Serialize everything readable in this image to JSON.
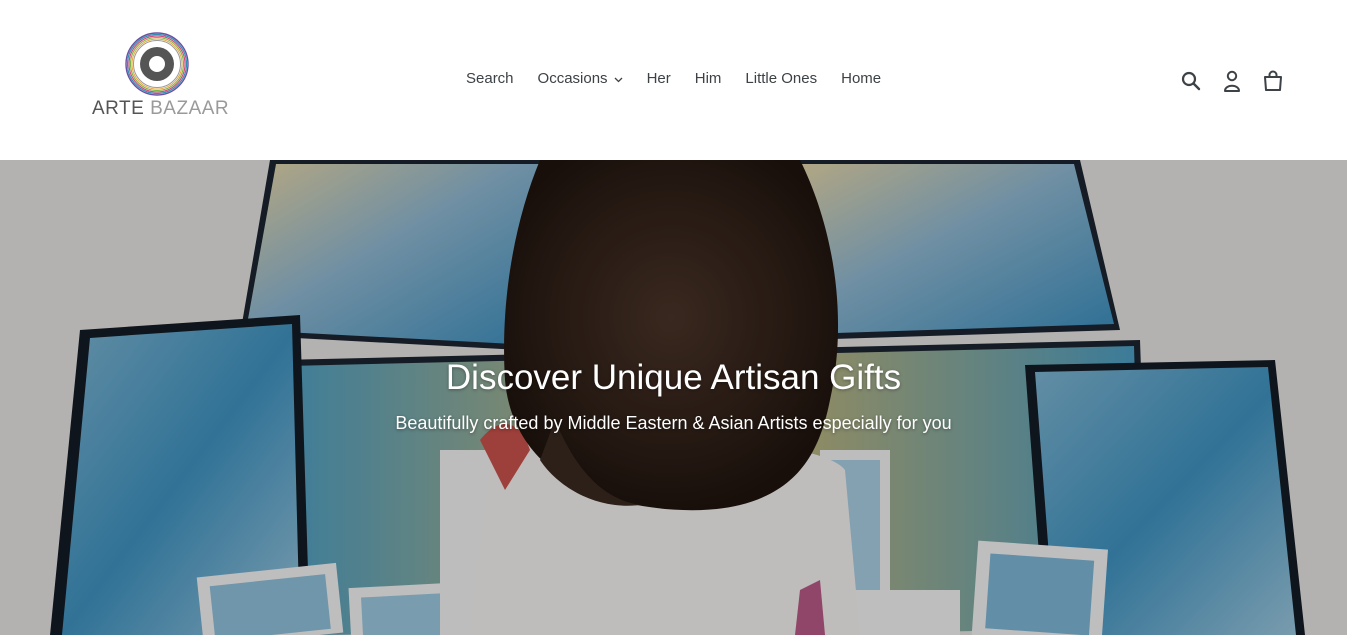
{
  "brand": {
    "word1": "ARTE",
    "word2": "BAZAAR"
  },
  "nav": {
    "items": [
      {
        "label": "Search"
      },
      {
        "label": "Occasions",
        "has_dropdown": true
      },
      {
        "label": "Her"
      },
      {
        "label": "Him"
      },
      {
        "label": "Little Ones"
      },
      {
        "label": "Home"
      }
    ]
  },
  "header_icons": [
    "search-icon",
    "account-icon",
    "cart-icon"
  ],
  "hero": {
    "title": "Discover Unique Artisan Gifts",
    "subtitle": "Beautifully crafted by Middle Eastern & Asian Artists especially for you"
  },
  "colors": {
    "text": "#3d4246",
    "logo_ring_inner": "#555555",
    "hero_text": "#ffffff"
  }
}
